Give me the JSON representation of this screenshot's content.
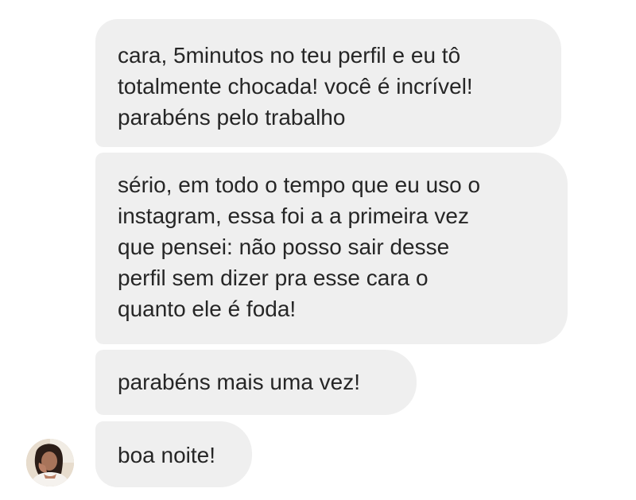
{
  "conversation": {
    "messages": [
      {
        "lines": [
          "cara, 5minutos no teu perfil e eu tô",
          "totalmente chocada! você é incrível!",
          "parabéns pelo trabalho"
        ]
      },
      {
        "lines": [
          "sério, em todo o tempo que eu uso o",
          "instagram, essa foi a a primeira vez",
          "que pensei: não posso sair desse",
          "perfil sem dizer pra esse cara o",
          "quanto ele é foda!"
        ]
      },
      {
        "lines": [
          "parabéns mais uma vez!"
        ]
      },
      {
        "lines": [
          "boa noite!"
        ]
      }
    ],
    "sender_avatar": {
      "icon": "profile-photo"
    },
    "colors": {
      "bubble_background": "#efefef",
      "text": "#262626",
      "page_background": "#ffffff"
    }
  }
}
